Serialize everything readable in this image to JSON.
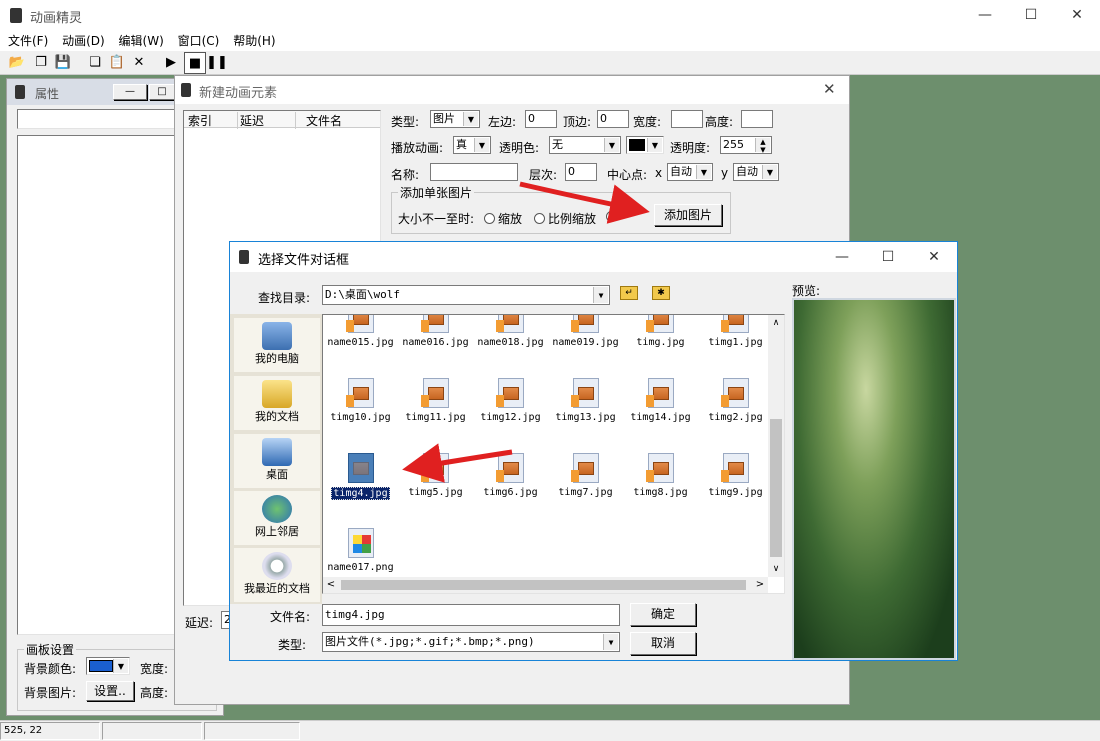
{
  "app": {
    "title": "动画精灵",
    "menu": [
      "文件(F)",
      "动画(D)",
      "编辑(W)",
      "窗口(C)",
      "帮助(H)"
    ],
    "status": [
      "525, 22",
      "",
      ""
    ]
  },
  "props": {
    "title": "属性",
    "canvas_group": "画板设置",
    "bg_color_label": "背景颜色:",
    "bg_color": "#1a5fd0",
    "width_label": "宽度:",
    "bg_image_label": "背景图片:",
    "settings_button": "设置..",
    "height_label": "高度:"
  },
  "new_element": {
    "title": "新建动画元素",
    "columns": [
      "索引",
      "延迟",
      "文件名"
    ],
    "delay_label": "延迟:",
    "delay_value": "2",
    "type_label": "类型:",
    "type_value": "图片",
    "left_label": "左边:",
    "left_value": "0",
    "top_label": "顶边:",
    "top_value": "0",
    "width_label": "宽度:",
    "width_value": "",
    "height_label": "高度:",
    "height_value": "",
    "play_label": "播放动画:",
    "play_value": "真",
    "transparent_label": "透明色:",
    "transparent_value": "无",
    "transparent_swatch": "#000000",
    "opacity_label": "透明度:",
    "opacity_value": "255",
    "name_label": "名称:",
    "name_value": "",
    "layer_label": "层次:",
    "layer_value": "0",
    "center_label": "中心点:",
    "x_label": "x",
    "x_value": "自动",
    "y_label": "y",
    "y_value": "自动",
    "single_group": "添加单张图片",
    "size_mismatch_label": "大小不一至时:",
    "opt_scale": "缩放",
    "opt_ratio": "比例缩放",
    "add_button": "添加图片"
  },
  "file_dialog": {
    "title": "选择文件对话框",
    "lookin_label": "查找目录:",
    "lookin_value": "D:\\桌面\\wolf",
    "preview_label": "预览:",
    "places": [
      "我的电脑",
      "我的文档",
      "桌面",
      "网上邻居",
      "我最近的文档"
    ],
    "files": [
      [
        "name015.jpg",
        "name016.jpg",
        "name018.jpg",
        "name019.jpg",
        "timg.jpg",
        "timg1.jpg"
      ],
      [
        "timg10.jpg",
        "timg11.jpg",
        "timg12.jpg",
        "timg13.jpg",
        "timg14.jpg",
        "timg2.jpg"
      ],
      [
        "timg4.jpg",
        "timg5.jpg",
        "timg6.jpg",
        "timg7.jpg",
        "timg8.jpg",
        "timg9.jpg"
      ],
      [
        "name017.png"
      ]
    ],
    "selected_file": "timg4.jpg",
    "filename_label": "文件名:",
    "filename_value": "timg4.jpg",
    "filetype_label": "类型:",
    "filetype_value": "图片文件(*.jpg;*.gif;*.bmp;*.png)",
    "ok_button": "确定",
    "cancel_button": "取消"
  },
  "icons": [
    "app-icon",
    "open-icon",
    "copy-icon",
    "save-icon",
    "paste-icon",
    "delete-icon",
    "play-icon",
    "stop-icon",
    "pause-icon",
    "folder-up-icon",
    "new-folder-icon",
    "computer-icon",
    "documents-icon",
    "desktop-icon",
    "network-icon",
    "recent-icon"
  ]
}
